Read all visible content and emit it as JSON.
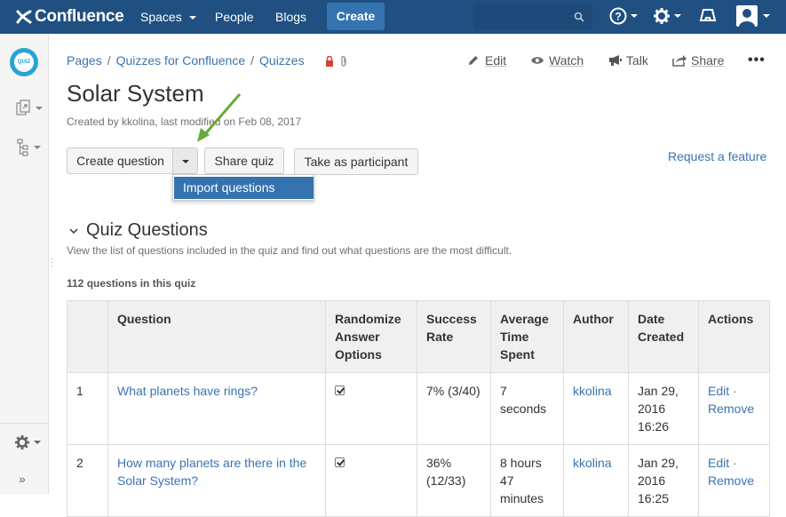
{
  "topnav": {
    "logo_text": "Confluence",
    "spaces_label": "Spaces",
    "people_label": "People",
    "blogs_label": "Blogs",
    "create_label": "Create",
    "search_placeholder": ""
  },
  "breadcrumb": [
    "Pages",
    "Quizzes for Confluence",
    "Quizzes"
  ],
  "page_actions": {
    "edit": "Edit",
    "watch": "Watch",
    "talk": "Talk",
    "share": "Share",
    "more": "•••"
  },
  "page": {
    "title": "Solar System",
    "byline": "Created by kkolina, last modified on Feb 08, 2017"
  },
  "buttons": {
    "create_question": "Create question",
    "share_quiz": "Share quiz",
    "take_as_participant": "Take as participant",
    "request_feature": "Request a feature"
  },
  "dropdown": {
    "import_questions": "Import questions"
  },
  "section": {
    "title": "Quiz Questions",
    "description": "View the list of questions included in the quiz and find out what questions are the most difficult.",
    "count": "112 questions in this quiz"
  },
  "table": {
    "headers": [
      "",
      "Question",
      "Randomize Answer Options",
      "Success Rate",
      "Average Time Spent",
      "Author",
      "Date Created",
      "Actions"
    ],
    "rows": [
      {
        "num": "1",
        "question": "What planets have rings?",
        "randomize": true,
        "success": "7% (3/40)",
        "time": "7 seconds",
        "author": "kkolina",
        "date": "Jan 29, 2016 16:26",
        "edit": "Edit",
        "remove": "Remove"
      },
      {
        "num": "2",
        "question": "How many planets are there in the Solar System?",
        "randomize": true,
        "success": "36% (12/33)",
        "time": "8 hours 47 minutes",
        "author": "kkolina",
        "date": "Jan 29, 2016 16:25",
        "edit": "Edit",
        "remove": "Remove"
      }
    ]
  },
  "sidebar": {
    "logo_text": "QUIZ"
  },
  "colors": {
    "nav_bg": "#205081",
    "link": "#3b73af",
    "create_btn": "#3572b0",
    "arrow": "#6aaa3a"
  }
}
